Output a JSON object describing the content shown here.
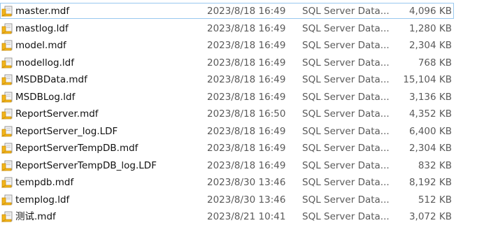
{
  "files": [
    {
      "name": "master.mdf",
      "date": "2023/8/18 16:49",
      "type": "SQL Server Data...",
      "size": "4,096 KB",
      "selected": true
    },
    {
      "name": "mastlog.ldf",
      "date": "2023/8/18 16:49",
      "type": "SQL Server Data...",
      "size": "1,280 KB"
    },
    {
      "name": "model.mdf",
      "date": "2023/8/18 16:49",
      "type": "SQL Server Data...",
      "size": "2,304 KB"
    },
    {
      "name": "modellog.ldf",
      "date": "2023/8/18 16:49",
      "type": "SQL Server Data...",
      "size": "768 KB"
    },
    {
      "name": "MSDBData.mdf",
      "date": "2023/8/18 16:49",
      "type": "SQL Server Data...",
      "size": "15,104 KB"
    },
    {
      "name": "MSDBLog.ldf",
      "date": "2023/8/18 16:49",
      "type": "SQL Server Data...",
      "size": "3,136 KB"
    },
    {
      "name": "ReportServer.mdf",
      "date": "2023/8/18 16:50",
      "type": "SQL Server Data...",
      "size": "4,352 KB"
    },
    {
      "name": "ReportServer_log.LDF",
      "date": "2023/8/18 16:49",
      "type": "SQL Server Data...",
      "size": "6,400 KB"
    },
    {
      "name": "ReportServerTempDB.mdf",
      "date": "2023/8/18 16:49",
      "type": "SQL Server Data...",
      "size": "2,304 KB"
    },
    {
      "name": "ReportServerTempDB_log.LDF",
      "date": "2023/8/18 16:49",
      "type": "SQL Server Data...",
      "size": "832 KB"
    },
    {
      "name": "tempdb.mdf",
      "date": "2023/8/30 13:46",
      "type": "SQL Server Data...",
      "size": "8,192 KB"
    },
    {
      "name": "templog.ldf",
      "date": "2023/8/30 13:46",
      "type": "SQL Server Data...",
      "size": "512 KB"
    },
    {
      "name": "测试.mdf",
      "date": "2023/8/21 10:41",
      "type": "SQL Server Data...",
      "size": "3,072 KB"
    }
  ],
  "icon": {
    "name": "sql-server-data-file-icon",
    "page_color": "#f4f4f4",
    "tab_color": "#f2b51b",
    "tab_shadow_color": "#c98a06"
  }
}
